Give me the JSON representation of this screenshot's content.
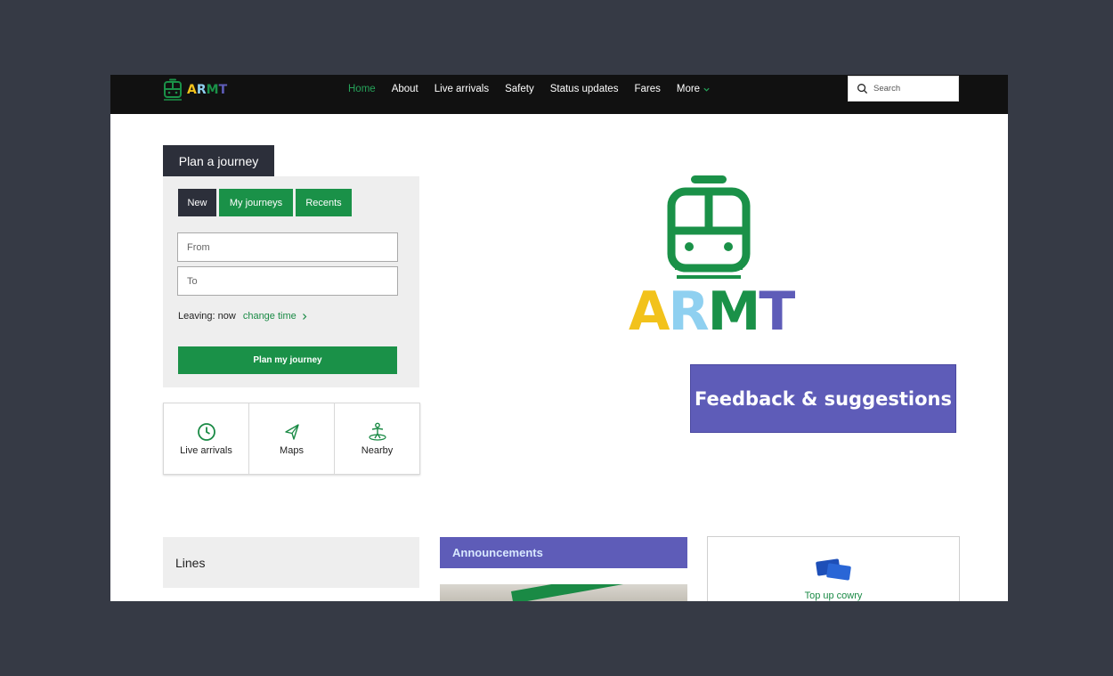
{
  "header": {
    "brand": [
      "A",
      "R",
      "M",
      "T"
    ],
    "nav": [
      {
        "label": "Home",
        "active": true
      },
      {
        "label": "About"
      },
      {
        "label": "Live arrivals"
      },
      {
        "label": "Safety"
      },
      {
        "label": "Status updates"
      },
      {
        "label": "Fares"
      }
    ],
    "more_label": "More",
    "search_placeholder": "Search"
  },
  "plan": {
    "title": "Plan a journey",
    "tabs": [
      "New",
      "My journeys",
      "Recents"
    ],
    "from_placeholder": "From",
    "to_placeholder": "To",
    "leaving_label": "Leaving: now",
    "change_time": "change time",
    "button": "Plan my journey"
  },
  "quick_links": [
    {
      "label": "Live arrivals",
      "icon": "clock-icon"
    },
    {
      "label": "Maps",
      "icon": "paper-plane-icon"
    },
    {
      "label": "Nearby",
      "icon": "nearby-person-icon"
    }
  ],
  "hero": {
    "letters": [
      "A",
      "R",
      "M",
      "T"
    ]
  },
  "feedback_label": "Feedback & suggestions",
  "lines_title": "Lines",
  "announcements_title": "Announcements",
  "topup_label": "Top up cowry",
  "colors": {
    "green": "#1a9148",
    "dark": "#2c2f3a",
    "purple": "#5e5cb8",
    "letter_a": "#f2c21b",
    "letter_r": "#8fd0f0",
    "letter_m": "#1a9148",
    "letter_t": "#5e5cb8"
  }
}
